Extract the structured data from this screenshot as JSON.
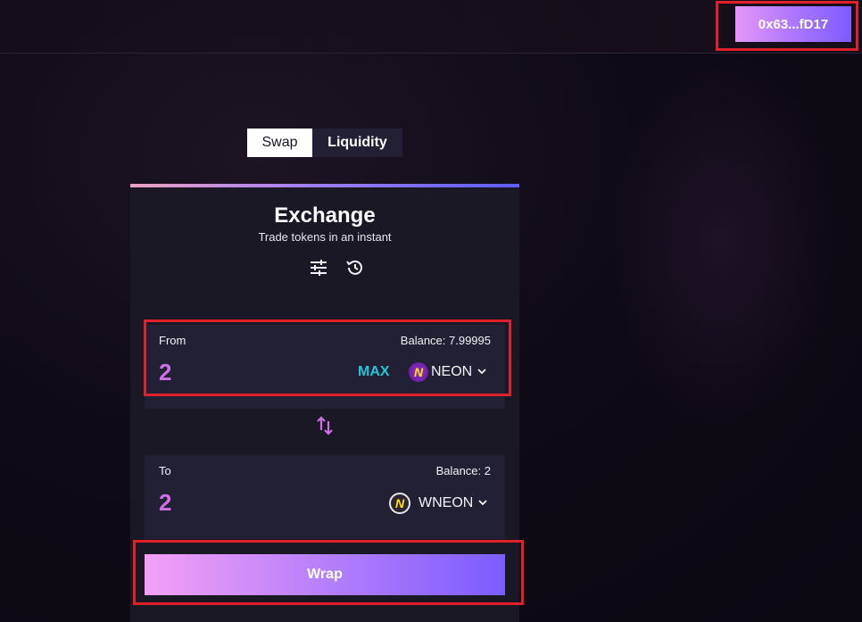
{
  "header": {
    "wallet_address": "0x63...fD17"
  },
  "tabs": [
    {
      "label": "Swap",
      "active": true
    },
    {
      "label": "Liquidity",
      "active": false
    }
  ],
  "exchange": {
    "title": "Exchange",
    "subtitle": "Trade tokens in an instant",
    "icons": [
      "settings-sliders-icon",
      "history-icon"
    ]
  },
  "from": {
    "label": "From",
    "balance": "Balance: 7.99995",
    "amount": "2",
    "max_label": "MAX",
    "token_symbol": "NEON",
    "token_logo_letter": "N"
  },
  "to": {
    "label": "To",
    "balance": "Balance: 2",
    "amount": "2",
    "token_symbol": "WNEON",
    "token_logo_letter": "N"
  },
  "action_button": {
    "label": "Wrap"
  },
  "colors": {
    "accent_pink": "#e497f8",
    "accent_purple": "#7c5cff",
    "amount_color": "#cf6fe8",
    "max_color": "#25c4d6",
    "highlight_red": "#e0202a"
  }
}
